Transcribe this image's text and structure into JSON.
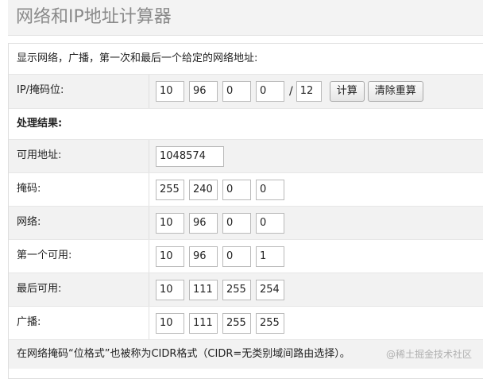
{
  "page_title": "网络和IP地址计算器",
  "description": "显示网络，广播，第一次和最后一个给定的网络地址:",
  "ip_row": {
    "label": "IP/掩码位:",
    "octets": [
      "10",
      "96",
      "0",
      "0"
    ],
    "slash": "/",
    "mask_bits": "12",
    "calc_button": "计算",
    "reset_button": "清除重算"
  },
  "results_heading": "处理结果:",
  "results": {
    "usable_count": {
      "label": "可用地址:",
      "value": "1048574"
    },
    "mask": {
      "label": "掩码:",
      "octets": [
        "255",
        "240",
        "0",
        "0"
      ]
    },
    "network": {
      "label": "网络:",
      "octets": [
        "10",
        "96",
        "0",
        "0"
      ]
    },
    "first_usable": {
      "label": "第一个可用:",
      "octets": [
        "10",
        "96",
        "0",
        "1"
      ]
    },
    "last_usable": {
      "label": "最后可用:",
      "octets": [
        "10",
        "111",
        "255",
        "254"
      ]
    },
    "broadcast": {
      "label": "广播:",
      "octets": [
        "10",
        "111",
        "255",
        "255"
      ]
    }
  },
  "footer_note": "在网络掩码“位格式”也被称为CIDR格式（CIDR=无类别域间路由选择）。",
  "watermark": "@稀土掘金技术社区"
}
